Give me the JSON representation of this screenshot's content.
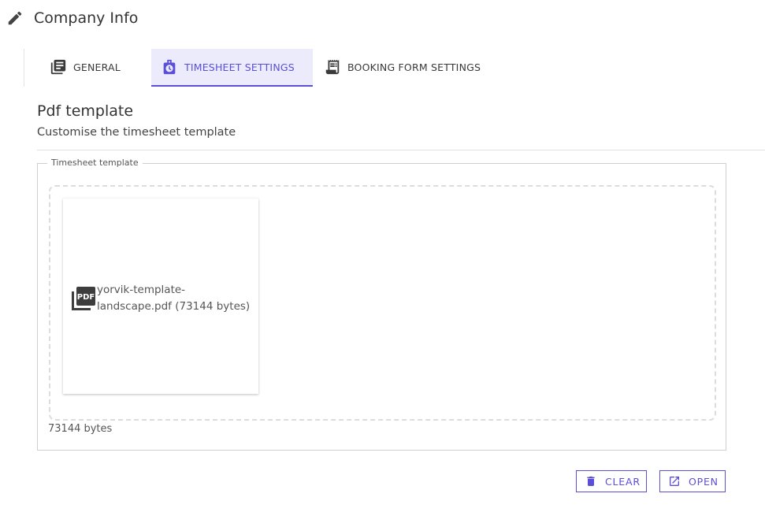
{
  "header": {
    "title": "Company Info",
    "icon": "pencil-icon"
  },
  "tabs": [
    {
      "label": "GENERAL",
      "icon": "library-books-icon",
      "active": false
    },
    {
      "label": "TIMESHEET SETTINGS",
      "icon": "timer-bag-icon",
      "active": true
    },
    {
      "label": "BOOKING FORM SETTINGS",
      "icon": "receipt-icon",
      "active": false
    }
  ],
  "section": {
    "title": "Pdf template",
    "subtitle": "Customise the timesheet template"
  },
  "fieldset": {
    "legend": "Timesheet template",
    "file": {
      "name": "yorvik-template-landscape.pdf (73144 bytes)",
      "icon": "pdf-icon"
    },
    "size_text": "73144 bytes"
  },
  "actions": {
    "clear_label": "CLEAR",
    "open_label": "OPEN"
  },
  "colors": {
    "accent": "#5b4fd6",
    "tab_active_bg": "#ecebfb"
  }
}
